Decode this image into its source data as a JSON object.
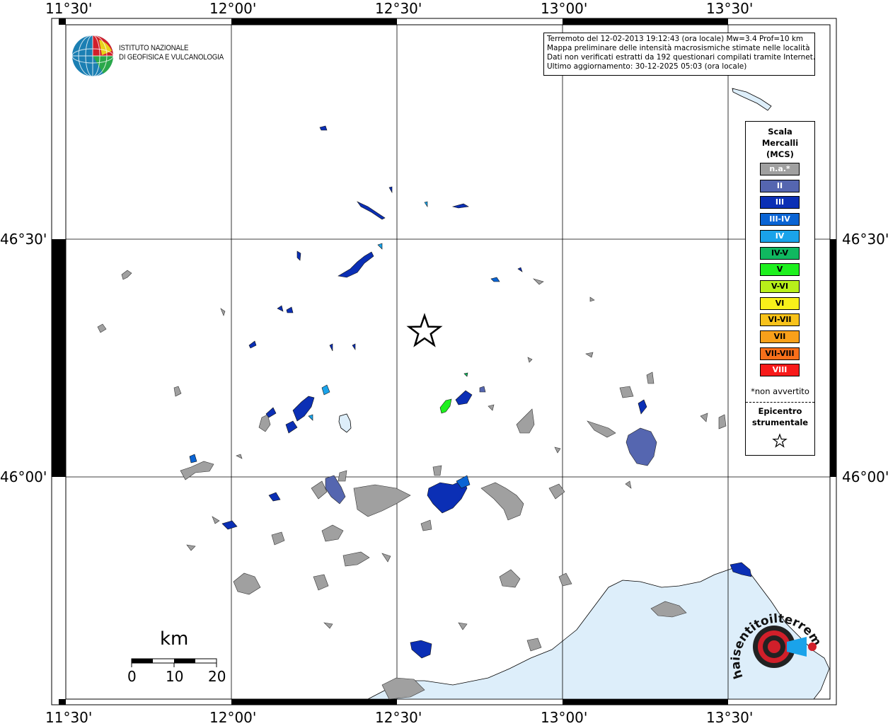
{
  "coords": {
    "lon_top": [
      "11°30'",
      "12°00'",
      "12°30'",
      "13°00'",
      "13°30'"
    ],
    "lon_bottom": [
      "11°30'",
      "12°00'",
      "12°30'",
      "13°00'",
      "13°30'"
    ],
    "lat_left": [
      "46°30'",
      "46°00'"
    ],
    "lat_right": [
      "46°30'",
      "46°00'"
    ]
  },
  "logo": {
    "line1": "ISTITUTO NAZIONALE",
    "line2": "DI GEOFISICA E VULCANOLOGIA"
  },
  "info": {
    "line1": "Terremoto del 12-02-2013 19:12:43 (ora locale) Mw=3.4 Prof=10 km",
    "line2": "Mappa preliminare delle intensità macrosismiche stimate nelle località",
    "line3": "Dati non verificati estratti da 192 questionari compilati tramite Internet.",
    "line4": "Ultimo aggiornamento: 30-12-2025 05:03 (ora locale)"
  },
  "legend": {
    "title1": "Scala",
    "title2": "Mercalli",
    "title3": "(MCS)",
    "items": [
      {
        "label": "n.a.*",
        "color": "#a0a0a0",
        "text_color": "#ffffff"
      },
      {
        "label": "II",
        "color": "#5566b0",
        "text_color": "#ffffff"
      },
      {
        "label": "III",
        "color": "#0b2fb5",
        "text_color": "#ffffff"
      },
      {
        "label": "III-IV",
        "color": "#0a64d4",
        "text_color": "#ffffff"
      },
      {
        "label": "IV",
        "color": "#1aa3ea",
        "text_color": "#ffffff"
      },
      {
        "label": "IV-V",
        "color": "#10b860",
        "text_color": "#000000"
      },
      {
        "label": "V",
        "color": "#1ef01e",
        "text_color": "#000000"
      },
      {
        "label": "V-VI",
        "color": "#b8f01a",
        "text_color": "#000000"
      },
      {
        "label": "VI",
        "color": "#f8f01a",
        "text_color": "#000000"
      },
      {
        "label": "VI-VII",
        "color": "#f8c21a",
        "text_color": "#000000"
      },
      {
        "label": "VII",
        "color": "#f8a01a",
        "text_color": "#000000"
      },
      {
        "label": "VII-VIII",
        "color": "#f86f1a",
        "text_color": "#000000"
      },
      {
        "label": "VIII",
        "color": "#f81a1a",
        "text_color": "#ffffff"
      }
    ],
    "note": "*non avvertito",
    "epi1": "Epicentro",
    "epi2": "strumentale"
  },
  "scalebar": {
    "unit": "km",
    "ticks": [
      "0",
      "10",
      "20"
    ]
  },
  "badge": {
    "text": "haisentitoilterremoto.it"
  },
  "colors": {
    "sea": "#ddeefa",
    "grid": "#000000"
  }
}
